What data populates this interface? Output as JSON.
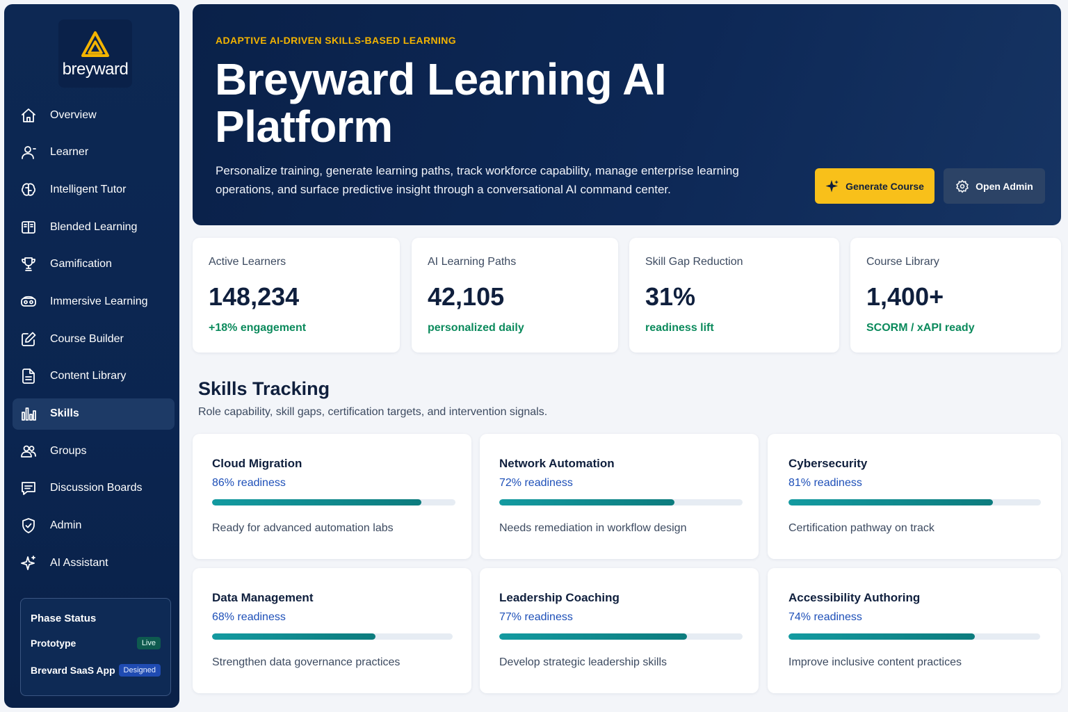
{
  "brand": {
    "name": "breyward"
  },
  "sidebar": {
    "items": [
      {
        "label": "Overview",
        "icon": "home-icon"
      },
      {
        "label": "Learner",
        "icon": "user-icon"
      },
      {
        "label": "Intelligent Tutor",
        "icon": "brain-icon"
      },
      {
        "label": "Blended Learning",
        "icon": "book-icon"
      },
      {
        "label": "Gamification",
        "icon": "trophy-icon"
      },
      {
        "label": "Immersive Learning",
        "icon": "vr-headset-icon"
      },
      {
        "label": "Course Builder",
        "icon": "edit-icon"
      },
      {
        "label": "Content Library",
        "icon": "document-icon"
      },
      {
        "label": "Skills",
        "icon": "bar-chart-icon",
        "active": true
      },
      {
        "label": "Groups",
        "icon": "users-icon"
      },
      {
        "label": "Discussion Boards",
        "icon": "message-icon"
      },
      {
        "label": "Admin",
        "icon": "shield-icon"
      },
      {
        "label": "AI Assistant",
        "icon": "sparkle-icon"
      }
    ],
    "phase": {
      "title": "Phase Status",
      "rows": [
        {
          "label": "Prototype",
          "badge": "Live"
        },
        {
          "label": "Brevard SaaS App",
          "badge": "Designed"
        }
      ]
    }
  },
  "hero": {
    "eyebrow": "ADAPTIVE AI-DRIVEN SKILLS-BASED LEARNING",
    "title": "Breyward Learning AI Platform",
    "description": "Personalize training, generate learning paths, track workforce capability, manage enterprise learning operations, and surface predictive insight through a conversational AI command center.",
    "primary_button": "Generate Course",
    "secondary_button": "Open Admin"
  },
  "stats": [
    {
      "label": "Active Learners",
      "value": "148,234",
      "sub": "+18% engagement"
    },
    {
      "label": "AI Learning Paths",
      "value": "42,105",
      "sub": "personalized daily"
    },
    {
      "label": "Skill Gap Reduction",
      "value": "31%",
      "sub": "readiness lift"
    },
    {
      "label": "Course Library",
      "value": "1,400+",
      "sub": "SCORM / xAPI ready"
    }
  ],
  "skills": {
    "title": "Skills Tracking",
    "subtitle": "Role capability, skill gaps, certification targets, and intervention signals.",
    "cards": [
      {
        "name": "Cloud Migration",
        "readiness": "86% readiness",
        "level": 0.86,
        "note": "Ready for advanced automation labs"
      },
      {
        "name": "Network Automation",
        "readiness": "72% readiness",
        "level": 0.72,
        "note": "Needs remediation in workflow design"
      },
      {
        "name": "Cybersecurity",
        "readiness": "81% readiness",
        "level": 0.81,
        "note": "Certification pathway on track"
      },
      {
        "name": "Data Management",
        "readiness": "68% readiness",
        "level": 0.68,
        "note": "Strengthen data governance practices"
      },
      {
        "name": "Leadership Coaching",
        "readiness": "77% readiness",
        "level": 0.77,
        "note": "Develop strategic leadership skills"
      },
      {
        "name": "Accessibility Authoring",
        "readiness": "74% readiness",
        "level": 0.74,
        "note": "Improve inclusive content practices"
      }
    ]
  },
  "colors": {
    "navy": "#0d2853",
    "accent": "#f8c01a",
    "success": "#0b8a5c",
    "link": "#1d4fb8",
    "progress": "#139aa0"
  }
}
